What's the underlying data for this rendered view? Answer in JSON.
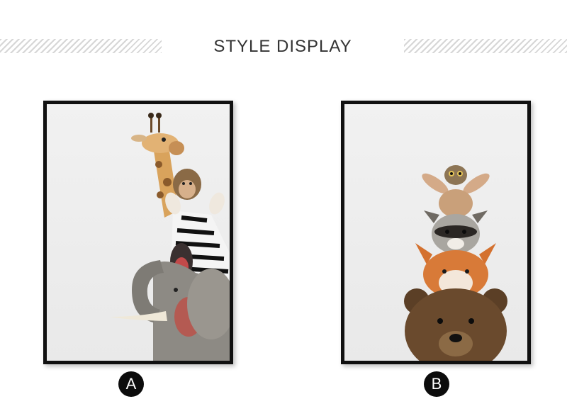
{
  "header": {
    "title": "STYLE DISPLAY"
  },
  "products": [
    {
      "label": "A",
      "subject": "stacked-safari-animals",
      "animals": [
        "giraffe",
        "monkey",
        "zebra",
        "elephant"
      ]
    },
    {
      "label": "B",
      "subject": "stacked-woodland-animals",
      "animals": [
        "owl",
        "rabbit",
        "raccoon",
        "fox",
        "bear"
      ]
    }
  ],
  "colors": {
    "frame": "#111111",
    "canvas": "#eeeeee",
    "badge": "#0c0c0c",
    "hatch": "#d6d6d6"
  }
}
